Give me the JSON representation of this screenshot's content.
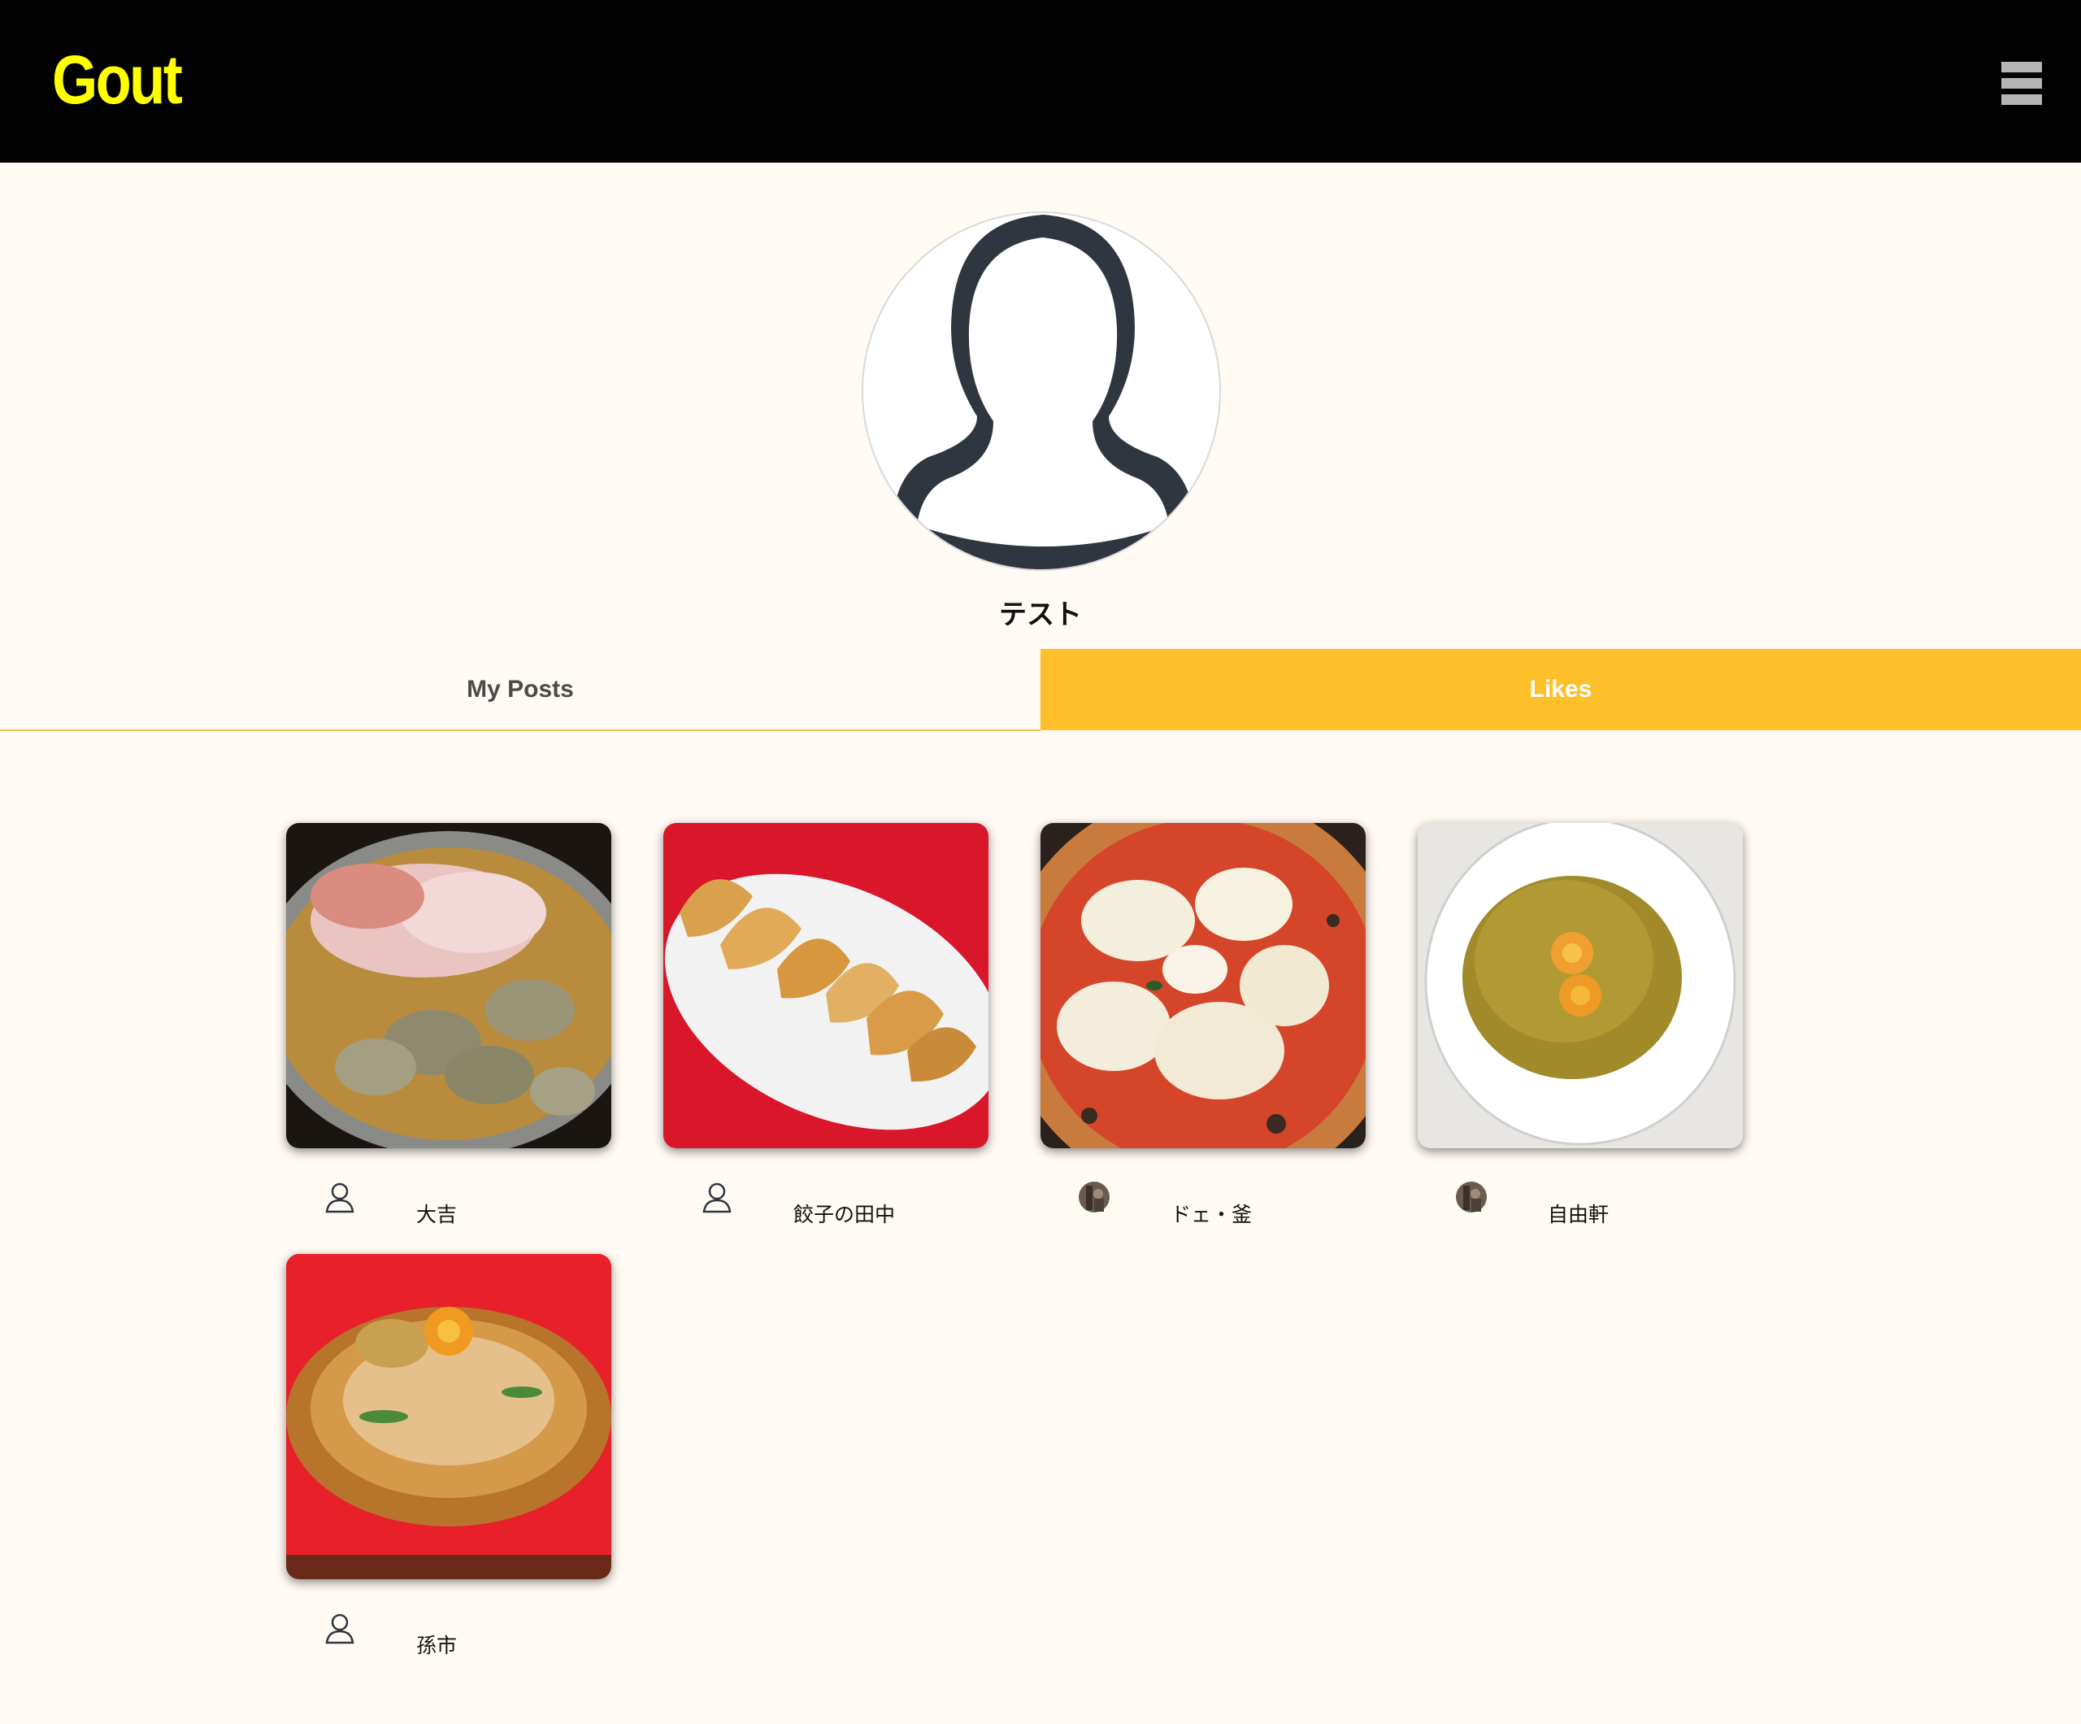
{
  "app": {
    "logo": "Gout",
    "menu_icon": "hamburger-menu-icon"
  },
  "profile": {
    "name": "テスト",
    "avatar_icon": "default-user-avatar-icon"
  },
  "tabs": [
    {
      "label": "My Posts",
      "active": false
    },
    {
      "label": "Likes",
      "active": true
    }
  ],
  "colors": {
    "header_bg": "#020202",
    "logo": "#ffff00",
    "accent": "#fdbf2a",
    "page_bg": "#fffaf3"
  },
  "posts": [
    {
      "shop": "大吉",
      "food": "oyster and offal hot pot",
      "user_icon": "default-user-icon"
    },
    {
      "shop": "餃子の田中",
      "food": "gyoza",
      "user_icon": "default-user-icon"
    },
    {
      "shop": "ドェ・釜",
      "food": "margherita pizza",
      "user_icon": "user-photo-avatar"
    },
    {
      "shop": "自由軒",
      "food": "curry rice with egg",
      "user_icon": "user-photo-avatar"
    },
    {
      "shop": "孫市",
      "food": "yakisoba with egg",
      "user_icon": "default-user-icon"
    }
  ]
}
